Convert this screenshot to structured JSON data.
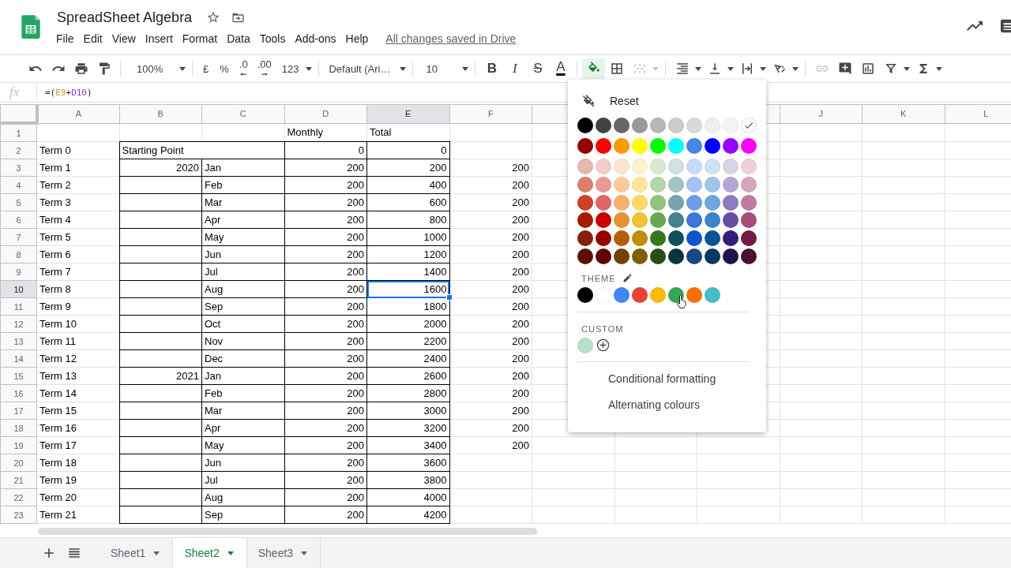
{
  "document": {
    "title": "SpreadSheet Algebra",
    "save_status": "All changes saved in Drive"
  },
  "menu": [
    "File",
    "Edit",
    "View",
    "Insert",
    "Format",
    "Data",
    "Tools",
    "Add-ons",
    "Help"
  ],
  "toolbar": {
    "zoom": "100%",
    "currency": "£",
    "percent": "%",
    "decrease_decimals": ".0",
    "increase_decimals": ".00",
    "number_format": "123",
    "font": "Default (Ari…",
    "font_size": "10",
    "bold": "B",
    "italic": "I",
    "strikethrough": "S",
    "text_color": "A",
    "fill_color_open": true
  },
  "formula_bar": {
    "label": "fx",
    "parts": [
      {
        "text": "=("
      },
      {
        "text": "E9",
        "color": "#e69138"
      },
      {
        "text": "+"
      },
      {
        "text": "D10",
        "color": "#9334e6"
      },
      {
        "text": ")"
      }
    ]
  },
  "columns": [
    {
      "label": "A",
      "selected": false
    },
    {
      "label": "B",
      "selected": false
    },
    {
      "label": "C",
      "selected": false
    },
    {
      "label": "D",
      "selected": false
    },
    {
      "label": "E",
      "selected": true
    },
    {
      "label": "F",
      "selected": false
    },
    null,
    null,
    null,
    {
      "label": "J",
      "selected": false
    },
    {
      "label": "K",
      "selected": false
    },
    {
      "label": "L",
      "selected": false
    }
  ],
  "rows": [
    {
      "number": "1",
      "selected": false,
      "bordered": false,
      "cells": [
        null,
        null,
        null,
        {
          "text": "Monthly",
          "kind": "text"
        },
        {
          "text": "Total",
          "kind": "text"
        },
        null
      ]
    },
    {
      "number": "2",
      "selected": false,
      "bordered": true,
      "cells": [
        {
          "text": "Term 0",
          "kind": "text"
        },
        {
          "text": "Starting Point",
          "kind": "merged"
        },
        null,
        {
          "text": "0",
          "kind": "number"
        },
        {
          "text": "0",
          "kind": "number"
        },
        null
      ]
    },
    {
      "number": "3",
      "selected": false,
      "bordered": true,
      "cells": [
        {
          "text": "Term 1",
          "kind": "text"
        },
        {
          "text": "2020",
          "kind": "number"
        },
        {
          "text": "Jan",
          "kind": "text"
        },
        {
          "text": "200",
          "kind": "number"
        },
        {
          "text": "200",
          "kind": "number"
        },
        {
          "text": "200",
          "kind": "number"
        }
      ]
    },
    {
      "number": "4",
      "selected": false,
      "bordered": true,
      "cells": [
        {
          "text": "Term 2",
          "kind": "text"
        },
        null,
        {
          "text": "Feb",
          "kind": "text"
        },
        {
          "text": "200",
          "kind": "number"
        },
        {
          "text": "400",
          "kind": "number"
        },
        {
          "text": "200",
          "kind": "number"
        }
      ]
    },
    {
      "number": "5",
      "selected": false,
      "bordered": true,
      "cells": [
        {
          "text": "Term 3",
          "kind": "text"
        },
        null,
        {
          "text": "Mar",
          "kind": "text"
        },
        {
          "text": "200",
          "kind": "number"
        },
        {
          "text": "600",
          "kind": "number"
        },
        {
          "text": "200",
          "kind": "number"
        }
      ]
    },
    {
      "number": "6",
      "selected": false,
      "bordered": true,
      "cells": [
        {
          "text": "Term 4",
          "kind": "text"
        },
        null,
        {
          "text": "Apr",
          "kind": "text"
        },
        {
          "text": "200",
          "kind": "number"
        },
        {
          "text": "800",
          "kind": "number"
        },
        {
          "text": "200",
          "kind": "number"
        }
      ]
    },
    {
      "number": "7",
      "selected": false,
      "bordered": true,
      "cells": [
        {
          "text": "Term 5",
          "kind": "text"
        },
        null,
        {
          "text": "May",
          "kind": "text"
        },
        {
          "text": "200",
          "kind": "number"
        },
        {
          "text": "1000",
          "kind": "number"
        },
        {
          "text": "200",
          "kind": "number"
        }
      ]
    },
    {
      "number": "8",
      "selected": false,
      "bordered": true,
      "cells": [
        {
          "text": "Term 6",
          "kind": "text"
        },
        null,
        {
          "text": "Jun",
          "kind": "text"
        },
        {
          "text": "200",
          "kind": "number"
        },
        {
          "text": "1200",
          "kind": "number"
        },
        {
          "text": "200",
          "kind": "number"
        }
      ]
    },
    {
      "number": "9",
      "selected": false,
      "bordered": true,
      "cells": [
        {
          "text": "Term 7",
          "kind": "text"
        },
        null,
        {
          "text": "Jul",
          "kind": "text"
        },
        {
          "text": "200",
          "kind": "number"
        },
        {
          "text": "1400",
          "kind": "number"
        },
        {
          "text": "200",
          "kind": "number"
        }
      ]
    },
    {
      "number": "10",
      "selected": true,
      "bordered": true,
      "cells": [
        {
          "text": "Term 8",
          "kind": "text"
        },
        null,
        {
          "text": "Aug",
          "kind": "text"
        },
        {
          "text": "200",
          "kind": "number"
        },
        {
          "text": "1600",
          "kind": "number"
        },
        {
          "text": "200",
          "kind": "number"
        }
      ]
    },
    {
      "number": "11",
      "selected": false,
      "bordered": true,
      "cells": [
        {
          "text": "Term 9",
          "kind": "text"
        },
        null,
        {
          "text": "Sep",
          "kind": "text"
        },
        {
          "text": "200",
          "kind": "number"
        },
        {
          "text": "1800",
          "kind": "number"
        },
        {
          "text": "200",
          "kind": "number"
        }
      ]
    },
    {
      "number": "12",
      "selected": false,
      "bordered": true,
      "cells": [
        {
          "text": "Term 10",
          "kind": "text"
        },
        null,
        {
          "text": "Oct",
          "kind": "text"
        },
        {
          "text": "200",
          "kind": "number"
        },
        {
          "text": "2000",
          "kind": "number"
        },
        {
          "text": "200",
          "kind": "number"
        }
      ]
    },
    {
      "number": "13",
      "selected": false,
      "bordered": true,
      "cells": [
        {
          "text": "Term 11",
          "kind": "text"
        },
        null,
        {
          "text": "Nov",
          "kind": "text"
        },
        {
          "text": "200",
          "kind": "number"
        },
        {
          "text": "2200",
          "kind": "number"
        },
        {
          "text": "200",
          "kind": "number"
        }
      ]
    },
    {
      "number": "14",
      "selected": false,
      "bordered": true,
      "cells": [
        {
          "text": "Term 12",
          "kind": "text"
        },
        null,
        {
          "text": "Dec",
          "kind": "text"
        },
        {
          "text": "200",
          "kind": "number"
        },
        {
          "text": "2400",
          "kind": "number"
        },
        {
          "text": "200",
          "kind": "number"
        }
      ]
    },
    {
      "number": "15",
      "selected": false,
      "bordered": true,
      "cells": [
        {
          "text": "Term 13",
          "kind": "text"
        },
        {
          "text": "2021",
          "kind": "number"
        },
        {
          "text": "Jan",
          "kind": "text"
        },
        {
          "text": "200",
          "kind": "number"
        },
        {
          "text": "2600",
          "kind": "number"
        },
        {
          "text": "200",
          "kind": "number"
        }
      ]
    },
    {
      "number": "16",
      "selected": false,
      "bordered": true,
      "cells": [
        {
          "text": "Term 14",
          "kind": "text"
        },
        null,
        {
          "text": "Feb",
          "kind": "text"
        },
        {
          "text": "200",
          "kind": "number"
        },
        {
          "text": "2800",
          "kind": "number"
        },
        {
          "text": "200",
          "kind": "number"
        }
      ]
    },
    {
      "number": "17",
      "selected": false,
      "bordered": true,
      "cells": [
        {
          "text": "Term 15",
          "kind": "text"
        },
        null,
        {
          "text": "Mar",
          "kind": "text"
        },
        {
          "text": "200",
          "kind": "number"
        },
        {
          "text": "3000",
          "kind": "number"
        },
        {
          "text": "200",
          "kind": "number"
        }
      ]
    },
    {
      "number": "18",
      "selected": false,
      "bordered": true,
      "cells": [
        {
          "text": "Term 16",
          "kind": "text"
        },
        null,
        {
          "text": "Apr",
          "kind": "text"
        },
        {
          "text": "200",
          "kind": "number"
        },
        {
          "text": "3200",
          "kind": "number"
        },
        {
          "text": "200",
          "kind": "number"
        }
      ]
    },
    {
      "number": "19",
      "selected": false,
      "bordered": true,
      "cells": [
        {
          "text": "Term 17",
          "kind": "text"
        },
        null,
        {
          "text": "May",
          "kind": "text"
        },
        {
          "text": "200",
          "kind": "number"
        },
        {
          "text": "3400",
          "kind": "number"
        },
        {
          "text": "200",
          "kind": "number"
        }
      ]
    },
    {
      "number": "20",
      "selected": false,
      "bordered": true,
      "cells": [
        {
          "text": "Term 18",
          "kind": "text"
        },
        null,
        {
          "text": "Jun",
          "kind": "text"
        },
        {
          "text": "200",
          "kind": "number"
        },
        {
          "text": "3600",
          "kind": "number"
        },
        null
      ]
    },
    {
      "number": "21",
      "selected": false,
      "bordered": true,
      "cells": [
        {
          "text": "Term 19",
          "kind": "text"
        },
        null,
        {
          "text": "Jul",
          "kind": "text"
        },
        {
          "text": "200",
          "kind": "number"
        },
        {
          "text": "3800",
          "kind": "number"
        },
        null
      ]
    },
    {
      "number": "22",
      "selected": false,
      "bordered": true,
      "cells": [
        {
          "text": "Term 20",
          "kind": "text"
        },
        null,
        {
          "text": "Aug",
          "kind": "text"
        },
        {
          "text": "200",
          "kind": "number"
        },
        {
          "text": "4000",
          "kind": "number"
        },
        null
      ]
    },
    {
      "number": "23",
      "selected": false,
      "bordered": true,
      "cells": [
        {
          "text": "Term 21",
          "kind": "text"
        },
        null,
        {
          "text": "Sep",
          "kind": "text"
        },
        {
          "text": "200",
          "kind": "number"
        },
        {
          "text": "4200",
          "kind": "number"
        },
        null
      ]
    }
  ],
  "fill_color_menu": {
    "reset": "Reset",
    "standard_rows": [
      [
        {
          "color": "#000000",
          "selected": false
        },
        {
          "color": "#434343",
          "selected": false
        },
        {
          "color": "#666666",
          "selected": false
        },
        {
          "color": "#999999",
          "selected": false
        },
        {
          "color": "#b7b7b7",
          "selected": false
        },
        {
          "color": "#cccccc",
          "selected": false
        },
        {
          "color": "#d9d9d9",
          "selected": false
        },
        {
          "color": "#efefef",
          "selected": false
        },
        {
          "color": "#f3f3f3",
          "selected": false
        },
        {
          "color": "#ffffff",
          "selected": true
        }
      ],
      [
        {
          "color": "#980000",
          "selected": false
        },
        {
          "color": "#ff0000",
          "selected": false
        },
        {
          "color": "#ff9900",
          "selected": false
        },
        {
          "color": "#ffff00",
          "selected": false
        },
        {
          "color": "#00ff00",
          "selected": false
        },
        {
          "color": "#00ffff",
          "selected": false
        },
        {
          "color": "#4a86e8",
          "selected": false
        },
        {
          "color": "#0000ff",
          "selected": false
        },
        {
          "color": "#9900ff",
          "selected": false
        },
        {
          "color": "#ff00ff",
          "selected": false
        }
      ],
      [
        {
          "color": "#e6b8af",
          "selected": false
        },
        {
          "color": "#f4cccc",
          "selected": false
        },
        {
          "color": "#fce5cd",
          "selected": false
        },
        {
          "color": "#fff2cc",
          "selected": false
        },
        {
          "color": "#d9ead3",
          "selected": false
        },
        {
          "color": "#d0e0e3",
          "selected": false
        },
        {
          "color": "#c9daf8",
          "selected": false
        },
        {
          "color": "#cfe2f3",
          "selected": false
        },
        {
          "color": "#d9d2e9",
          "selected": false
        },
        {
          "color": "#ead1dc",
          "selected": false
        }
      ],
      [
        {
          "color": "#dd7e6b",
          "selected": false
        },
        {
          "color": "#ea9999",
          "selected": false
        },
        {
          "color": "#f9cb9c",
          "selected": false
        },
        {
          "color": "#ffe599",
          "selected": false
        },
        {
          "color": "#b6d7a8",
          "selected": false
        },
        {
          "color": "#a2c4c9",
          "selected": false
        },
        {
          "color": "#a4c2f4",
          "selected": false
        },
        {
          "color": "#9fc5e8",
          "selected": false
        },
        {
          "color": "#b4a7d6",
          "selected": false
        },
        {
          "color": "#d5a6bd",
          "selected": false
        }
      ],
      [
        {
          "color": "#cc4125",
          "selected": false
        },
        {
          "color": "#e06666",
          "selected": false
        },
        {
          "color": "#f6b26b",
          "selected": false
        },
        {
          "color": "#ffd966",
          "selected": false
        },
        {
          "color": "#93c47d",
          "selected": false
        },
        {
          "color": "#76a5af",
          "selected": false
        },
        {
          "color": "#6d9eeb",
          "selected": false
        },
        {
          "color": "#6fa8dc",
          "selected": false
        },
        {
          "color": "#8e7cc3",
          "selected": false
        },
        {
          "color": "#c27ba0",
          "selected": false
        }
      ],
      [
        {
          "color": "#a61c00",
          "selected": false
        },
        {
          "color": "#cc0000",
          "selected": false
        },
        {
          "color": "#e69138",
          "selected": false
        },
        {
          "color": "#f1c232",
          "selected": false
        },
        {
          "color": "#6aa84f",
          "selected": false
        },
        {
          "color": "#45818e",
          "selected": false
        },
        {
          "color": "#3c78d8",
          "selected": false
        },
        {
          "color": "#3d85c6",
          "selected": false
        },
        {
          "color": "#674ea7",
          "selected": false
        },
        {
          "color": "#a64d79",
          "selected": false
        }
      ],
      [
        {
          "color": "#85200c",
          "selected": false
        },
        {
          "color": "#990000",
          "selected": false
        },
        {
          "color": "#b45f06",
          "selected": false
        },
        {
          "color": "#bf9000",
          "selected": false
        },
        {
          "color": "#38761d",
          "selected": false
        },
        {
          "color": "#134f5c",
          "selected": false
        },
        {
          "color": "#1155cc",
          "selected": false
        },
        {
          "color": "#0b5394",
          "selected": false
        },
        {
          "color": "#351c75",
          "selected": false
        },
        {
          "color": "#741b47",
          "selected": false
        }
      ],
      [
        {
          "color": "#5b0f00",
          "selected": false
        },
        {
          "color": "#660000",
          "selected": false
        },
        {
          "color": "#783f04",
          "selected": false
        },
        {
          "color": "#7f6000",
          "selected": false
        },
        {
          "color": "#274e13",
          "selected": false
        },
        {
          "color": "#0c343d",
          "selected": false
        },
        {
          "color": "#1c4587",
          "selected": false
        },
        {
          "color": "#073763",
          "selected": false
        },
        {
          "color": "#20124d",
          "selected": false
        },
        {
          "color": "#4c1130",
          "selected": false
        }
      ]
    ],
    "theme_label": "THEME",
    "theme": [
      {
        "color": "#000000",
        "selected": false
      },
      {
        "color": "#ffffff",
        "selected": false
      },
      {
        "color": "#4285f4",
        "selected": false
      },
      {
        "color": "#ea4335",
        "selected": false
      },
      {
        "color": "#fbbc04",
        "selected": false
      },
      {
        "color": "#34a853",
        "selected": false
      },
      {
        "color": "#ff6d01",
        "selected": false
      },
      {
        "color": "#46bdc6",
        "selected": false
      }
    ],
    "custom_label": "CUSTOM",
    "custom": [
      {
        "color": "#b7e1cd",
        "selected": false
      }
    ],
    "actions": [
      "Conditional formatting",
      "Alternating colours"
    ]
  },
  "sheets": [
    {
      "name": "Sheet1",
      "selected": false
    },
    {
      "name": "Sheet2",
      "selected": true
    },
    {
      "name": "Sheet3",
      "selected": false
    }
  ]
}
